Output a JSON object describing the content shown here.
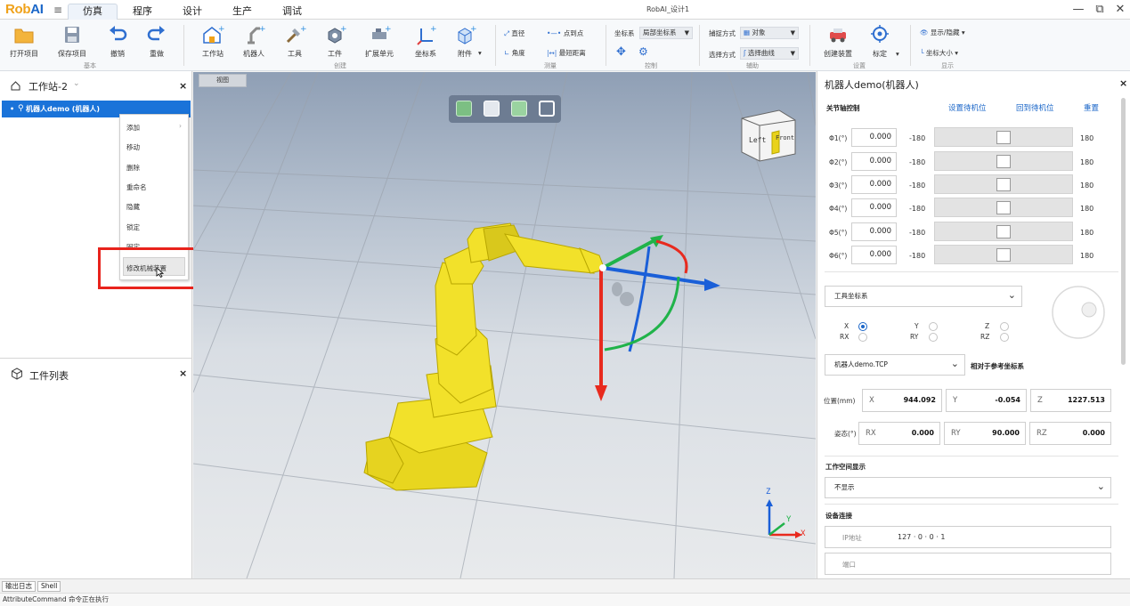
{
  "logo": {
    "part1": "Rob",
    "part2": "AI"
  },
  "menu_tabs": [
    {
      "label": "仿真"
    },
    {
      "label": "程序"
    },
    {
      "label": "设计"
    },
    {
      "label": "生产"
    },
    {
      "label": "调试"
    }
  ],
  "window_title": "RobAI_设计1",
  "window_controls": {
    "minimize": "—",
    "restore": "⧉",
    "close": "✕"
  },
  "ribbon": {
    "buttons": [
      {
        "label": "打开项目",
        "icon": "folder-icon"
      },
      {
        "label": "保存项目",
        "icon": "save-icon"
      },
      {
        "label": "撤销",
        "icon": "undo-icon"
      },
      {
        "label": "重做",
        "icon": "redo-icon"
      },
      {
        "label": "工作站",
        "icon": "workstation-icon"
      },
      {
        "label": "机器人",
        "icon": "robot-icon"
      },
      {
        "label": "工具",
        "icon": "tool-icon"
      },
      {
        "label": "工件",
        "icon": "workpiece-icon"
      },
      {
        "label": "扩展单元",
        "icon": "extension-icon"
      },
      {
        "label": "坐标系",
        "icon": "frame-icon"
      },
      {
        "label": "附件",
        "icon": "attachment-icon"
      },
      {
        "label": "创建装置",
        "icon": "create-device-icon"
      },
      {
        "label": "标定",
        "icon": "calibrate-icon"
      }
    ],
    "groups": [
      "基本",
      "创建",
      "测量",
      "控制",
      "辅助",
      "设置",
      "显示"
    ],
    "measure": {
      "straight": "直径",
      "p2p": "点到点",
      "angle": "角度",
      "min_dist": "最短距离"
    },
    "control": {
      "frame_label": "坐标系",
      "frame_value": "局部坐标系"
    },
    "assist": {
      "snap_label": "捕捉方式",
      "snap_value": "对象",
      "select_label": "选择方式",
      "select_value": "选择曲线"
    },
    "display": {
      "show_hide": "显示/隐藏",
      "frame_size": "坐标大小"
    }
  },
  "left_panel": {
    "title": "工作站-2",
    "tree_item": "机器人demo (机器人)",
    "context_menu": [
      "添加",
      "移动",
      "删除",
      "重命名",
      "隐藏",
      "锁定",
      "固定",
      "修改机械装置"
    ],
    "worklist_title": "工件列表"
  },
  "viewport": {
    "tab": "视图",
    "cube_left": "Left",
    "cube_front": "Front",
    "axis_z": "Z",
    "axis_y": "Y",
    "axis_x": "X"
  },
  "right_panel": {
    "title": "机器人demo(机器人)",
    "joint_section": "关节轴控制",
    "set_standby": "设置待机位",
    "go_standby": "回到待机位",
    "reset": "重置",
    "joints": [
      {
        "label": "Φ1(°)",
        "value": "0.000",
        "min": "-180",
        "max": "180"
      },
      {
        "label": "Φ2(°)",
        "value": "0.000",
        "min": "-180",
        "max": "180"
      },
      {
        "label": "Φ3(°)",
        "value": "0.000",
        "min": "-180",
        "max": "180"
      },
      {
        "label": "Φ4(°)",
        "value": "0.000",
        "min": "-180",
        "max": "180"
      },
      {
        "label": "Φ5(°)",
        "value": "0.000",
        "min": "-180",
        "max": "180"
      },
      {
        "label": "Φ6(°)",
        "value": "0.000",
        "min": "-180",
        "max": "180"
      }
    ],
    "tool_frame": "工具坐标系",
    "radios": [
      "X",
      "RX",
      "Y",
      "RY",
      "Z",
      "RZ"
    ],
    "tcp": "机器人demo.TCP",
    "relative_label": "相对于参考坐标系",
    "position_label": "位置(mm)",
    "pose_label": "姿态(°)",
    "pos": [
      {
        "k": "X",
        "v": "944.092"
      },
      {
        "k": "Y",
        "v": "-0.054"
      },
      {
        "k": "Z",
        "v": "1227.513"
      }
    ],
    "rot": [
      {
        "k": "RX",
        "v": "0.000"
      },
      {
        "k": "RY",
        "v": "90.000"
      },
      {
        "k": "RZ",
        "v": "0.000"
      }
    ],
    "workspace_section": "工作空间显示",
    "workspace_value": "不显示",
    "device_section": "设备连接",
    "ip_label": "IP地址",
    "ip_value": "127 · 0 · 0 · 1",
    "port_label": "端口"
  },
  "bottom_tabs": [
    "输出日志",
    "Shell"
  ],
  "status": "AttributeCommand 命令正在执行",
  "colors": {
    "accent": "#1a73d9",
    "highlight": "#e8231c",
    "robot": "#f2e12a"
  }
}
